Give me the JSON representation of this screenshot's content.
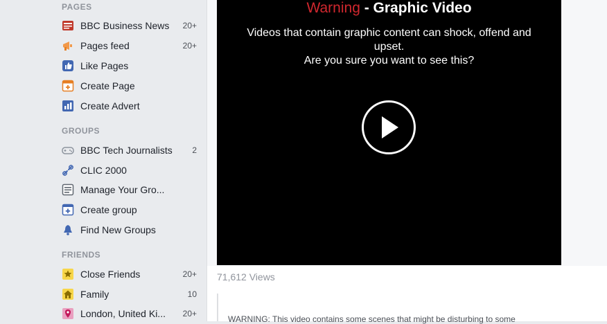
{
  "sidebar": {
    "pages": {
      "title": "PAGES",
      "items": [
        {
          "label": "BBC Business News",
          "count": "20+",
          "icon": "bbc-news-icon"
        },
        {
          "label": "Pages feed",
          "count": "20+",
          "icon": "megaphone-icon"
        },
        {
          "label": "Like Pages",
          "count": "",
          "icon": "thumbs-up-icon"
        },
        {
          "label": "Create Page",
          "count": "",
          "icon": "create-page-icon"
        },
        {
          "label": "Create Advert",
          "count": "",
          "icon": "bar-chart-icon"
        }
      ]
    },
    "groups": {
      "title": "GROUPS",
      "items": [
        {
          "label": "BBC Tech Journalists",
          "count": "2",
          "icon": "gamepad-icon"
        },
        {
          "label": "CLIC 2000",
          "count": "",
          "icon": "link-icon"
        },
        {
          "label": "Manage Your Gro...",
          "count": "",
          "icon": "list-icon"
        },
        {
          "label": "Create group",
          "count": "",
          "icon": "plus-box-icon"
        },
        {
          "label": "Find New Groups",
          "count": "",
          "icon": "bell-icon"
        }
      ]
    },
    "friends": {
      "title": "FRIENDS",
      "items": [
        {
          "label": "Close Friends",
          "count": "20+",
          "icon": "star-icon"
        },
        {
          "label": "Family",
          "count": "10",
          "icon": "house-icon"
        },
        {
          "label": "London, United Ki...",
          "count": "20+",
          "icon": "location-pin-icon"
        }
      ]
    }
  },
  "video": {
    "warning_word": "Warning",
    "title_rest": " - Graphic Video",
    "message_line1": "Videos that contain graphic content can shock, offend and upset.",
    "message_line2": "Are you sure you want to see this?"
  },
  "post": {
    "views": "71,612 Views",
    "warning_text": "WARNING: This video contains some scenes that might be disturbing to some"
  },
  "colors": {
    "warning_red": "#d0272e",
    "link_blue": "#4267b2"
  }
}
